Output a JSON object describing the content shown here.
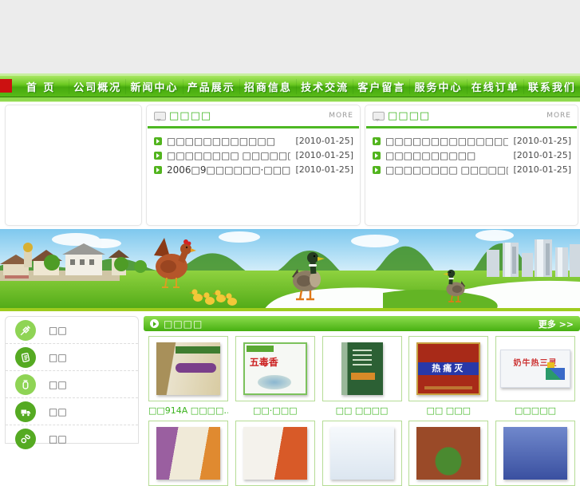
{
  "brand": {
    "accent_red": "#cc1111",
    "nav_green": "#4cb515",
    "title_green": "#3cb41e",
    "caption_green": "#3cb41e",
    "date_color": "#4a4a4a"
  },
  "nav": {
    "items": [
      "首 页",
      "公司概况",
      "新闻中心",
      "产品展示",
      "招商信息",
      "技术交流",
      "客户留言",
      "服务中心",
      "在线订单",
      "联系我们"
    ]
  },
  "news_left": {
    "title": "□□□□",
    "more_label": "MORE",
    "items": [
      {
        "text": "□□□□□□□□□□□□",
        "date": "[2010-01-25]"
      },
      {
        "text": "□□□□□□□□ □□□□□□□□…",
        "date": "[2010-01-25]"
      },
      {
        "text": "2006□9□□□□□□·□□□…",
        "date": "[2010-01-25]"
      }
    ]
  },
  "news_right": {
    "title": "□□□□",
    "more_label": "MORE",
    "items": [
      {
        "text": "□□□□□□□□□□□□□□□□□…",
        "date": "[2010-01-25]"
      },
      {
        "text": "□□□□□□□□□□",
        "date": "[2010-01-25]"
      },
      {
        "text": "□□□□□□□□ □□□□□□□□",
        "date": "[2010-01-25]"
      }
    ]
  },
  "sidebar": {
    "items": [
      {
        "label": "□□",
        "icon": "syringe-icon"
      },
      {
        "label": "□□",
        "icon": "notepad-icon"
      },
      {
        "label": "□□",
        "icon": "bottle-icon"
      },
      {
        "label": "□□",
        "icon": "truck-icon"
      },
      {
        "label": "□□",
        "icon": "pills-icon"
      }
    ]
  },
  "products": {
    "title": "□□□□",
    "more_label": "更多 >>",
    "items": [
      {
        "caption": "□□914A □□□□…",
        "box_text": ""
      },
      {
        "caption": "□□·□□□",
        "box_text": "五毒香"
      },
      {
        "caption": "□□ □□□□",
        "box_text": ""
      },
      {
        "caption": "□□ □□□",
        "box_text": "热痛灭"
      },
      {
        "caption": "□□□□□",
        "box_text": "奶牛热三灵"
      }
    ]
  }
}
